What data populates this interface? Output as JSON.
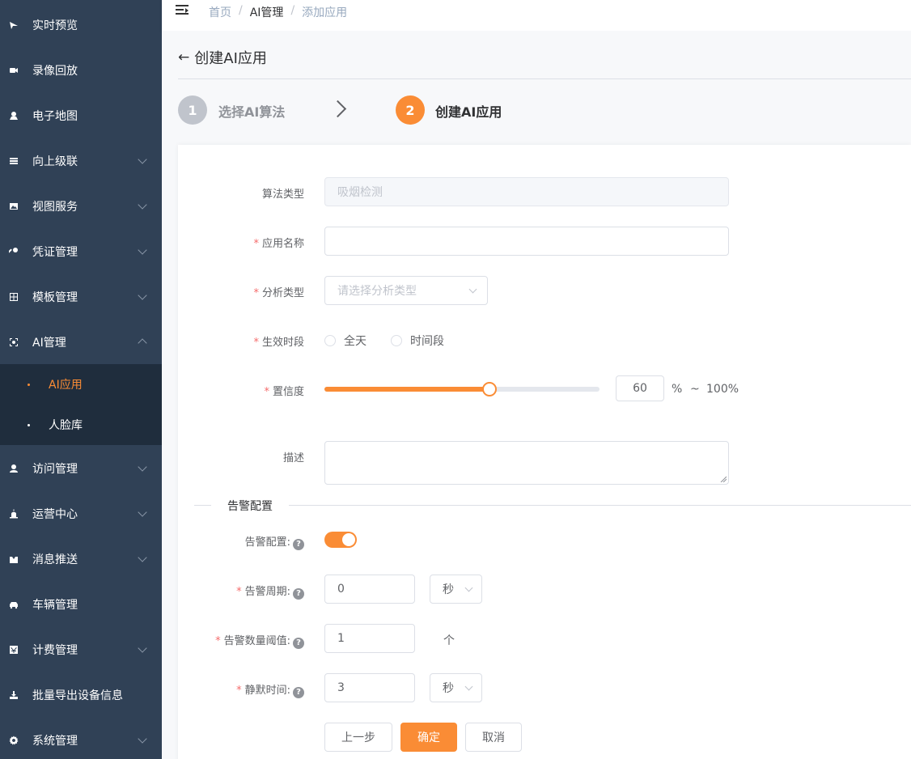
{
  "sidebar": {
    "items": [
      {
        "label": "实时预览",
        "icon": "live-preview-icon",
        "chevron": false
      },
      {
        "label": "录像回放",
        "icon": "video-playback-icon",
        "chevron": false
      },
      {
        "label": "电子地图",
        "icon": "map-icon",
        "chevron": false
      },
      {
        "label": "向上级联",
        "icon": "cascade-icon",
        "chevron": true
      },
      {
        "label": "视图服务",
        "icon": "image-icon",
        "chevron": true
      },
      {
        "label": "凭证管理",
        "icon": "key-icon",
        "chevron": true
      },
      {
        "label": "模板管理",
        "icon": "template-icon",
        "chevron": true
      },
      {
        "label": "AI管理",
        "icon": "ai-icon",
        "chevron": true,
        "expanded": true
      },
      {
        "label": "访问管理",
        "icon": "user-icon",
        "chevron": true
      },
      {
        "label": "运营中心",
        "icon": "alarm-icon",
        "chevron": true
      },
      {
        "label": "消息推送",
        "icon": "inbox-icon",
        "chevron": true
      },
      {
        "label": "车辆管理",
        "icon": "car-icon",
        "chevron": false
      },
      {
        "label": "计费管理",
        "icon": "billing-icon",
        "chevron": true
      },
      {
        "label": "批量导出设备信息",
        "icon": "export-icon",
        "chevron": false
      },
      {
        "label": "系统管理",
        "icon": "gear-icon",
        "chevron": true
      }
    ],
    "submenu": [
      {
        "label": "AI应用",
        "active": true
      },
      {
        "label": "人脸库",
        "active": false
      }
    ]
  },
  "breadcrumb": [
    "首页",
    "AI管理",
    "添加应用"
  ],
  "breadcrumb_sep": "/",
  "page": {
    "back_arrow": "←",
    "title": "创建AI应用"
  },
  "steps": [
    {
      "number": "1",
      "title": "选择AI算法",
      "active": false
    },
    {
      "number": "2",
      "title": "创建AI应用",
      "active": true
    }
  ],
  "form": {
    "required_mark": "*",
    "algorithm_type": {
      "label": "算法类型",
      "value": "吸烟检测"
    },
    "app_name": {
      "label": "应用名称",
      "value": ""
    },
    "analysis_type": {
      "label": "分析类型",
      "placeholder": "请选择分析类型"
    },
    "effective_time": {
      "label": "生效时段",
      "options": [
        "全天",
        "时间段"
      ]
    },
    "confidence": {
      "label": "置信度",
      "value": "60",
      "percent": 60,
      "unit": "%",
      "tilde": "~",
      "max": "100%"
    },
    "description": {
      "label": "描述",
      "value": ""
    }
  },
  "alarm": {
    "section_title": "告警配置",
    "switch": {
      "label": "告警配置:",
      "on": true
    },
    "period": {
      "label": "告警周期:",
      "value": "0",
      "unit": "秒"
    },
    "threshold": {
      "label": "告警数量阈值:",
      "value": "1",
      "unit": "个"
    },
    "silence": {
      "label": "静默时间:",
      "value": "3",
      "unit": "秒"
    },
    "help_glyph": "?"
  },
  "buttons": {
    "prev": "上一步",
    "confirm": "确定",
    "cancel": "取消"
  },
  "colors": {
    "sidebar_bg": "#304156",
    "submenu_bg": "#1f2d3d",
    "accent": "#fa8c35",
    "step_inactive": "#c0c4cc"
  }
}
